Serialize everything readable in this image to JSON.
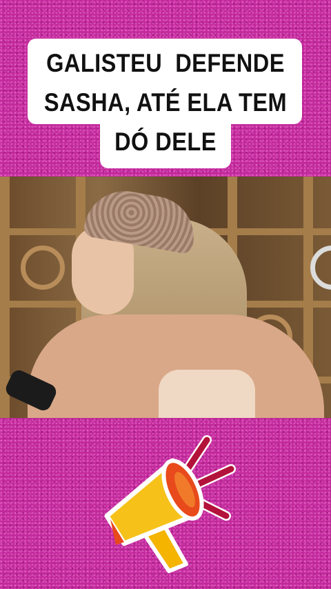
{
  "caption": {
    "line1": "GALISTEU  DEFENDE",
    "line2": "SASHA, ATÉ ELA TEM",
    "line3": "DÓ DELE"
  },
  "colors": {
    "background": "#c2289b",
    "caption_box": "#ffffff",
    "caption_text": "#111111"
  },
  "video": {
    "description_icon": "video-frame"
  },
  "sticker": {
    "icon": "megaphone-icon"
  }
}
